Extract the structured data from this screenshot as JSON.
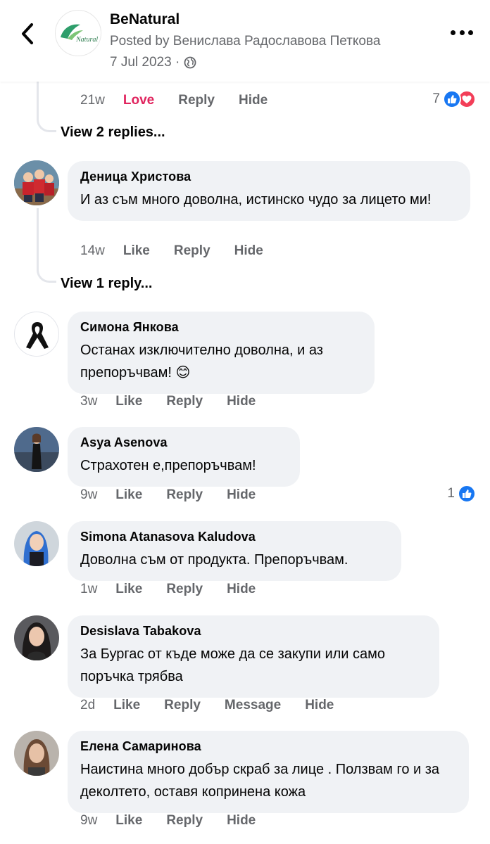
{
  "header": {
    "page_name": "BeNatural",
    "posted_by": "Posted by Венислава Радославова Петкова",
    "date": "7 Jul 2023 ·",
    "logo_text": "Natural"
  },
  "prev_comment": {
    "time": "21w",
    "love_label": "Love",
    "reply_label": "Reply",
    "hide_label": "Hide",
    "reactions": "7"
  },
  "view_replies_1": "View 2 replies...",
  "view_replies_2": "View 1 reply...",
  "comments": [
    {
      "author": "Деница Христова",
      "text": "И аз съм много доволна, истинско чудо за лицето ми!",
      "time": "14w",
      "like": "Like",
      "reply": "Reply",
      "hide": "Hide"
    },
    {
      "author": "Симона Янкова",
      "text": "Останах изключително доволна, и аз препоръчвам! 😊",
      "time": "3w",
      "like": "Like",
      "reply": "Reply",
      "hide": "Hide"
    },
    {
      "author": "Asya Asenova",
      "text": "Страхотен е,препоръчвам!",
      "time": "9w",
      "like": "Like",
      "reply": "Reply",
      "hide": "Hide",
      "reactions": "1"
    },
    {
      "author": "Simona Atanasova Kaludova",
      "text": "Доволна съм от продукта. Препоръчвам.",
      "time": "1w",
      "like": "Like",
      "reply": "Reply",
      "hide": "Hide"
    },
    {
      "author": "Desislava Tabakova",
      "text": "За Бургас от къде може да се закупи или само поръчка трябва",
      "time": "2d",
      "like": "Like",
      "reply": "Reply",
      "message": "Message",
      "hide": "Hide"
    },
    {
      "author": "Елена Самаринова",
      "text": "Наистина много добър скраб за лице . Ползвам го и за деколтето, оставя копринена кожа",
      "time": "9w",
      "like": "Like",
      "reply": "Reply",
      "hide": "Hide"
    }
  ],
  "colors": {
    "bubble": "#f0f2f5",
    "meta": "#65676b",
    "love": "#e0245e",
    "like_blue": "#1877f2",
    "love_red": "#f33e58",
    "brand_green": "#2e9e6b"
  },
  "icons": [
    "back-arrow-icon",
    "globe-icon",
    "more-options-icon",
    "like-reaction-icon",
    "love-reaction-icon"
  ]
}
